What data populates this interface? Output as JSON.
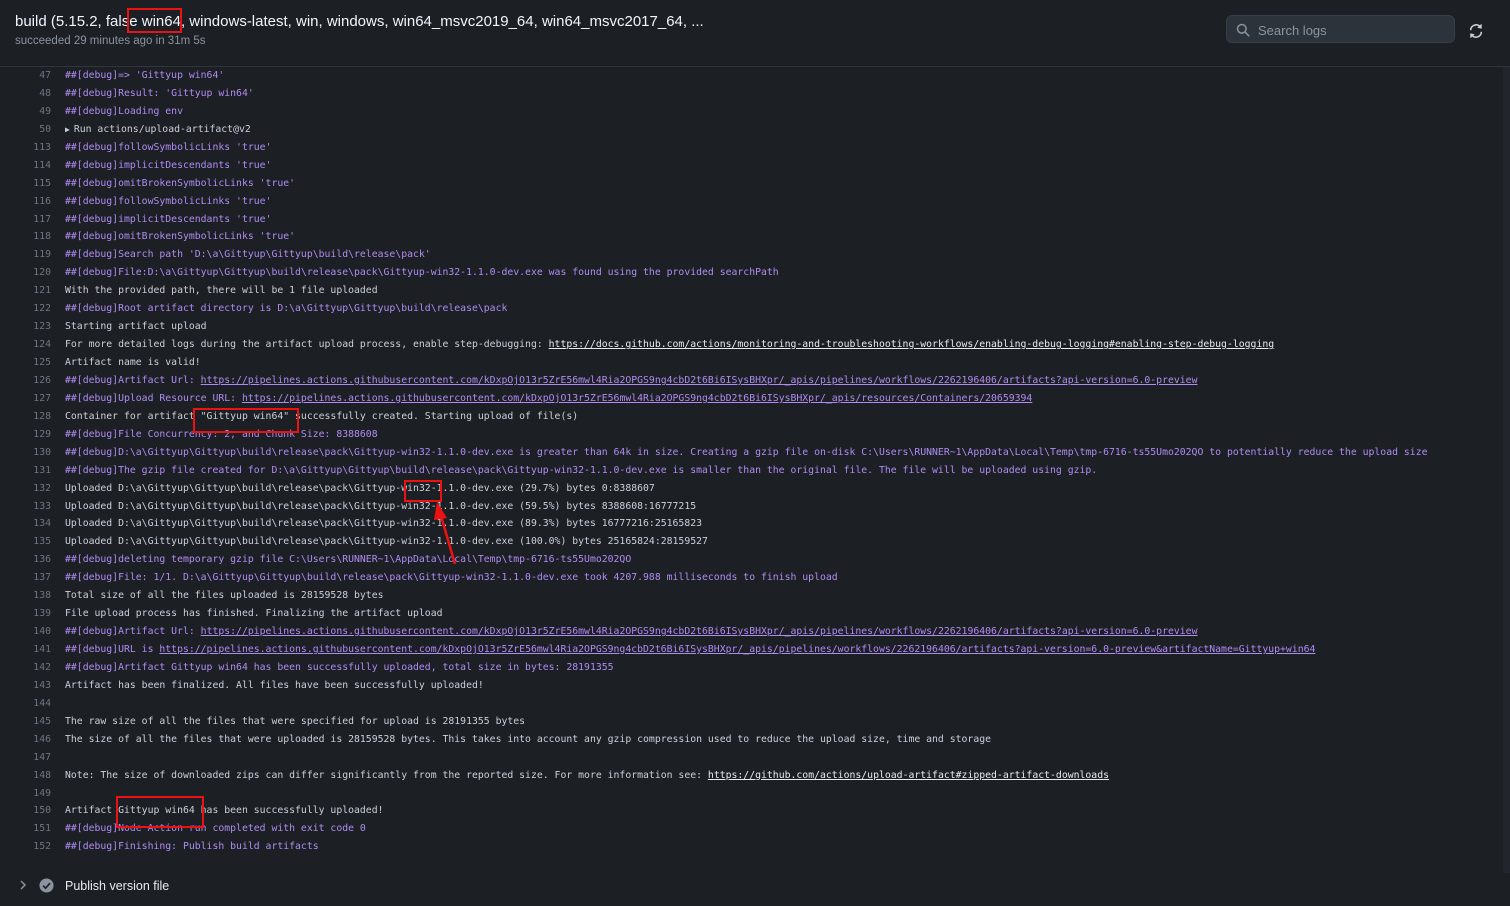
{
  "job": {
    "title_prefix": "build (5.15.2, false",
    "title_highlight": "win64",
    "title_suffix": ", windows-latest, win, windows, win64_msvc2019_64, win64_msvc2017_64, ...",
    "status": "succeeded 29 minutes ago in 31m 5s"
  },
  "search": {
    "placeholder": "Search logs"
  },
  "icons": {
    "search": "search-icon",
    "refresh": "refresh-icon",
    "expand": "chevron-right-icon",
    "success": "check-circle-icon"
  },
  "colors": {
    "background": "#1c1f24",
    "debug": "#b08cf2",
    "line_number": "#6e7681",
    "highlight": "#ee1111"
  },
  "log_lines": [
    {
      "n": "47",
      "debug": true,
      "t": "##[debug]=> 'Gittyup win64'"
    },
    {
      "n": "48",
      "debug": true,
      "t": "##[debug]Result: 'Gittyup win64'"
    },
    {
      "n": "49",
      "debug": true,
      "t": "##[debug]Loading env"
    },
    {
      "n": "50",
      "debug": false,
      "group": true,
      "t": "Run actions/upload-artifact@v2"
    },
    {
      "n": "113",
      "debug": true,
      "t": "##[debug]followSymbolicLinks 'true'"
    },
    {
      "n": "114",
      "debug": true,
      "t": "##[debug]implicitDescendants 'true'"
    },
    {
      "n": "115",
      "debug": true,
      "t": "##[debug]omitBrokenSymbolicLinks 'true'"
    },
    {
      "n": "116",
      "debug": true,
      "t": "##[debug]followSymbolicLinks 'true'"
    },
    {
      "n": "117",
      "debug": true,
      "t": "##[debug]implicitDescendants 'true'"
    },
    {
      "n": "118",
      "debug": true,
      "t": "##[debug]omitBrokenSymbolicLinks 'true'"
    },
    {
      "n": "119",
      "debug": true,
      "t": "##[debug]Search path 'D:\\a\\Gittyup\\Gittyup\\build\\release\\pack'"
    },
    {
      "n": "120",
      "debug": true,
      "t": "##[debug]File:D:\\a\\Gittyup\\Gittyup\\build\\release\\pack\\Gittyup-win32-1.1.0-dev.exe was found using the provided searchPath"
    },
    {
      "n": "121",
      "debug": false,
      "t": "With the provided path, there will be 1 file uploaded"
    },
    {
      "n": "122",
      "debug": true,
      "t": "##[debug]Root artifact directory is D:\\a\\Gittyup\\Gittyup\\build\\release\\pack"
    },
    {
      "n": "123",
      "debug": false,
      "t": "Starting artifact upload"
    },
    {
      "n": "124",
      "debug": false,
      "t": "For more detailed logs during the artifact upload process, enable step-debugging: ",
      "link": "https://docs.github.com/actions/monitoring-and-troubleshooting-workflows/enabling-debug-logging#enabling-step-debug-logging"
    },
    {
      "n": "125",
      "debug": false,
      "t": "Artifact name is valid!"
    },
    {
      "n": "126",
      "debug": true,
      "t": "##[debug]Artifact Url: ",
      "link": "https://pipelines.actions.githubusercontent.com/kDxpOjO13r5ZrE56mwl4Ria2OPGS9ng4cbD2t6Bi6ISysBHXpr/_apis/pipelines/workflows/2262196406/artifacts?api-version=6.0-preview"
    },
    {
      "n": "127",
      "debug": true,
      "t": "##[debug]Upload Resource URL: ",
      "link": "https://pipelines.actions.githubusercontent.com/kDxpOjO13r5ZrE56mwl4Ria2OPGS9ng4cbD2t6Bi6ISysBHXpr/_apis/resources/Containers/20659394"
    },
    {
      "n": "128",
      "debug": false,
      "t": "Container for artifact \"Gittyup win64\" successfully created. Starting upload of file(s)"
    },
    {
      "n": "129",
      "debug": true,
      "t": "##[debug]File Concurrency: 2, and Chunk Size: 8388608"
    },
    {
      "n": "130",
      "debug": true,
      "t": "##[debug]D:\\a\\Gittyup\\Gittyup\\build\\release\\pack\\Gittyup-win32-1.1.0-dev.exe is greater than 64k in size. Creating a gzip file on-disk C:\\Users\\RUNNER~1\\AppData\\Local\\Temp\\tmp-6716-ts55Umo202QO to potentially reduce the upload size"
    },
    {
      "n": "131",
      "debug": true,
      "t": "##[debug]The gzip file created for D:\\a\\Gittyup\\Gittyup\\build\\release\\pack\\Gittyup-win32-1.1.0-dev.exe is smaller than the original file. The file will be uploaded using gzip."
    },
    {
      "n": "132",
      "debug": false,
      "t": "Uploaded D:\\a\\Gittyup\\Gittyup\\build\\release\\pack\\Gittyup-win32-1.1.0-dev.exe (29.7%) bytes 0:8388607"
    },
    {
      "n": "133",
      "debug": false,
      "t": "Uploaded D:\\a\\Gittyup\\Gittyup\\build\\release\\pack\\Gittyup-win32-1.1.0-dev.exe (59.5%) bytes 8388608:16777215"
    },
    {
      "n": "134",
      "debug": false,
      "t": "Uploaded D:\\a\\Gittyup\\Gittyup\\build\\release\\pack\\Gittyup-win32-1.1.0-dev.exe (89.3%) bytes 16777216:25165823"
    },
    {
      "n": "135",
      "debug": false,
      "t": "Uploaded D:\\a\\Gittyup\\Gittyup\\build\\release\\pack\\Gittyup-win32-1.1.0-dev.exe (100.0%) bytes 25165824:28159527"
    },
    {
      "n": "136",
      "debug": true,
      "t": "##[debug]deleting temporary gzip file C:\\Users\\RUNNER~1\\AppData\\Local\\Temp\\tmp-6716-ts55Umo202QO"
    },
    {
      "n": "137",
      "debug": true,
      "t": "##[debug]File: 1/1. D:\\a\\Gittyup\\Gittyup\\build\\release\\pack\\Gittyup-win32-1.1.0-dev.exe took 4207.988 milliseconds to finish upload"
    },
    {
      "n": "138",
      "debug": false,
      "t": "Total size of all the files uploaded is 28159528 bytes"
    },
    {
      "n": "139",
      "debug": false,
      "t": "File upload process has finished. Finalizing the artifact upload"
    },
    {
      "n": "140",
      "debug": true,
      "t": "##[debug]Artifact Url: ",
      "link": "https://pipelines.actions.githubusercontent.com/kDxpOjO13r5ZrE56mwl4Ria2OPGS9ng4cbD2t6Bi6ISysBHXpr/_apis/pipelines/workflows/2262196406/artifacts?api-version=6.0-preview"
    },
    {
      "n": "141",
      "debug": true,
      "t": "##[debug]URL is ",
      "link": "https://pipelines.actions.githubusercontent.com/kDxpOjO13r5ZrE56mwl4Ria2OPGS9ng4cbD2t6Bi6ISysBHXpr/_apis/pipelines/workflows/2262196406/artifacts?api-version=6.0-preview&artifactName=Gittyup+win64"
    },
    {
      "n": "142",
      "debug": true,
      "t": "##[debug]Artifact Gittyup win64 has been successfully uploaded, total size in bytes: 28191355"
    },
    {
      "n": "143",
      "debug": false,
      "t": "Artifact has been finalized. All files have been successfully uploaded!"
    },
    {
      "n": "144",
      "debug": false,
      "t": ""
    },
    {
      "n": "145",
      "debug": false,
      "t": "The raw size of all the files that were specified for upload is 28191355 bytes"
    },
    {
      "n": "146",
      "debug": false,
      "t": "The size of all the files that were uploaded is 28159528 bytes. This takes into account any gzip compression used to reduce the upload size, time and storage"
    },
    {
      "n": "147",
      "debug": false,
      "t": ""
    },
    {
      "n": "148",
      "debug": false,
      "t": "Note: The size of downloaded zips can differ significantly from the reported size. For more information see: ",
      "link": "https://github.com/actions/upload-artifact#zipped-artifact-downloads"
    },
    {
      "n": "149",
      "debug": false,
      "t": ""
    },
    {
      "n": "150",
      "debug": false,
      "t": "Artifact Gittyup win64 has been successfully uploaded!"
    },
    {
      "n": "151",
      "debug": true,
      "t": "##[debug]Node Action run completed with exit code 0"
    },
    {
      "n": "152",
      "debug": true,
      "t": "##[debug]Finishing: Publish build artifacts"
    }
  ],
  "next_step": {
    "label": "Publish version file"
  }
}
